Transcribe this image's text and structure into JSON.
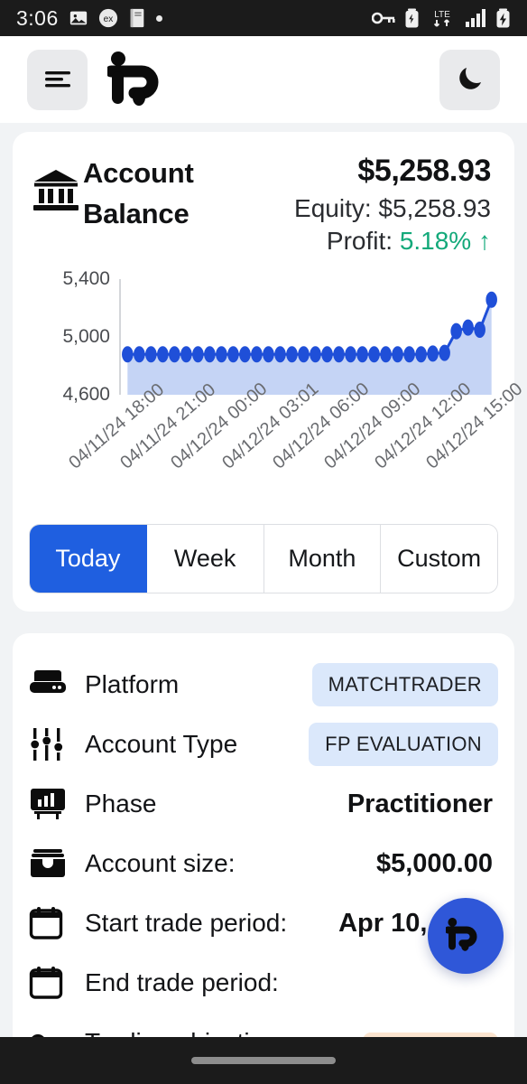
{
  "status_bar": {
    "time": "3:06",
    "left_icons": [
      "photo-icon",
      "ex-badge-icon",
      "bible-book-icon",
      "dot-icon"
    ],
    "right_icons": [
      "vpn-key-icon",
      "battery-saver-icon",
      "lte-data-icon",
      "signal-bars-icon",
      "battery-charging-icon"
    ],
    "lte_label": "LTE",
    "background": "#1b1b1b"
  },
  "header": {
    "menu_icon": "hamburger-menu-icon",
    "logo": "fp-logo",
    "theme_toggle_icon": "moon-icon"
  },
  "balance_card": {
    "icon": "bank-icon",
    "title": "Account Balance",
    "amount": "$5,258.93",
    "equity_label": "Equity:",
    "equity_value": "$5,258.93",
    "profit_label": "Profit:",
    "profit_value": "5.18%",
    "profit_arrow": "↑",
    "profit_color": "#13a97a"
  },
  "range_tabs": {
    "options": [
      "Today",
      "Week",
      "Month",
      "Custom"
    ],
    "selected": "Today",
    "active_color": "#1f5fe0"
  },
  "chart_data": {
    "type": "area",
    "title": "",
    "xlabel": "",
    "ylabel": "",
    "ylim": [
      4600,
      5400
    ],
    "yticks": [
      "5,400",
      "5,000",
      "4,600"
    ],
    "ytick_values": [
      5400,
      5000,
      4600
    ],
    "grid": false,
    "legend": "none",
    "line_color": "#1f4fd8",
    "fill_color": "#c5d4f5",
    "marker": "circle",
    "tick_labels": [
      "04/11/24 18:00",
      "04/11/24 21:00",
      "04/12/24 00:00",
      "04/12/24 03:01",
      "04/12/24 06:00",
      "04/12/24 09:00",
      "04/12/24 12:00",
      "04/12/24 15:00"
    ],
    "values": [
      4880,
      4880,
      4880,
      4880,
      4880,
      4880,
      4880,
      4880,
      4880,
      4880,
      4880,
      4880,
      4880,
      4880,
      4880,
      4880,
      4880,
      4880,
      4880,
      4880,
      4880,
      4880,
      4880,
      4880,
      4880,
      4880,
      4885,
      4890,
      5040,
      5065,
      5050,
      5258
    ]
  },
  "details_card": {
    "rows": [
      {
        "icon": "server-icon",
        "label": "Platform",
        "value": "MATCHTRADER",
        "value_type": "badge"
      },
      {
        "icon": "sliders-icon",
        "label": "Account Type",
        "value": "FP EVALUATION",
        "value_type": "badge"
      },
      {
        "icon": "presentation-icon",
        "label": "Phase",
        "value": "Practitioner",
        "value_type": "text"
      },
      {
        "icon": "wallet-icon",
        "label": "Account size:",
        "value": "$5,000.00",
        "value_type": "text"
      },
      {
        "icon": "calendar-icon",
        "label": "Start trade period:",
        "value": "Apr 10, 2024",
        "value_type": "text"
      },
      {
        "icon": "calendar-icon",
        "label": "End trade period:",
        "value": "",
        "value_type": "text"
      }
    ],
    "clipped_row": {
      "icon": "key-icon",
      "label": "Trading objectives",
      "value": "",
      "value_type": "badge-warn"
    }
  },
  "fab": {
    "icon": "fp-logo",
    "color": "#2f57d8"
  },
  "nav_bar": {
    "gesture_pill": true
  }
}
